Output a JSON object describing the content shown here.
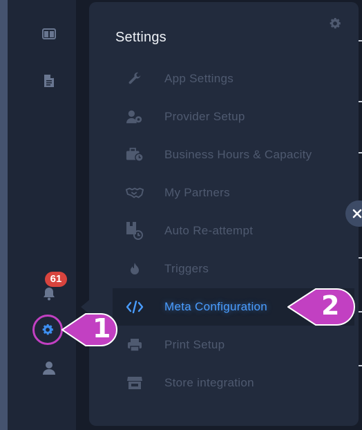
{
  "sidebar": {
    "items": [
      {
        "icon": "columns-icon"
      },
      {
        "icon": "document-icon"
      },
      {
        "icon": "bell-icon",
        "badge": "61"
      },
      {
        "icon": "gear-icon",
        "selected": true
      },
      {
        "icon": "user-icon"
      }
    ]
  },
  "settings_panel": {
    "title": "Settings",
    "header_icon": "gear-icon",
    "items": [
      {
        "label": "App Settings",
        "icon": "wrench-icon"
      },
      {
        "label": "Provider Setup",
        "icon": "user-gear-icon"
      },
      {
        "label": "Business Hours & Capacity",
        "icon": "briefcase-clock-icon"
      },
      {
        "label": "My Partners",
        "icon": "handshake-icon"
      },
      {
        "label": "Auto Re-attempt",
        "icon": "reattempt-icon"
      },
      {
        "label": "Triggers",
        "icon": "fire-icon"
      },
      {
        "label": "Meta Configuration",
        "icon": "code-icon",
        "active": true
      },
      {
        "label": "Print Setup",
        "icon": "printer-icon"
      },
      {
        "label": "Store integration",
        "icon": "store-icon"
      }
    ]
  },
  "annotations": [
    {
      "number": "1",
      "target": "sidebar gear"
    },
    {
      "number": "2",
      "target": "Meta Configuration"
    }
  ],
  "colors": {
    "accent": "#4a9dff",
    "callout": "#c240c2",
    "badge": "#d8443e"
  }
}
